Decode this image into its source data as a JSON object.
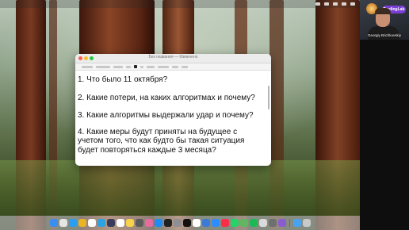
{
  "window": {
    "title": "Без названия — Изменено"
  },
  "questions": [
    "1. Что было 11 октября?",
    "2. Какие потери, на каких алгоритмах и почему?",
    "3. Какие алгоритмы выдержали удар и почему?",
    "4. Какие меры будут приняты  на будущее с\nучетом того, что как будто бы такая ситуация\nбудет повторяться каждые 3 месяца?"
  ],
  "video": {
    "participant_name": "Georgiy Brichkovskiy",
    "sign_text": "TradingLab"
  },
  "colors": {
    "traffic_close": "#ff5f57",
    "traffic_min": "#febc2e",
    "traffic_max": "#28c840",
    "sign": "#7b3fd6"
  },
  "dock": {
    "icons": [
      {
        "name": "finder-icon",
        "color": "#3b8df0"
      },
      {
        "name": "launchpad-icon",
        "color": "#e5e5e5"
      },
      {
        "name": "safari-icon",
        "color": "#2a9df4"
      },
      {
        "name": "chrome-icon",
        "color": "#e9b526"
      },
      {
        "name": "yandex-icon",
        "color": "#fbfbfb"
      },
      {
        "name": "telegram-icon",
        "color": "#2aa3e0"
      },
      {
        "name": "shield-icon",
        "color": "#3a3a5a"
      },
      {
        "name": "calendar-icon",
        "color": "#ffffff"
      },
      {
        "name": "notes-icon",
        "color": "#f7d34a"
      },
      {
        "name": "app-icon",
        "color": "#5b5b5b"
      },
      {
        "name": "photos-icon",
        "color": "#e86ba0"
      },
      {
        "name": "appstore-icon",
        "color": "#1e8cf2"
      },
      {
        "name": "stocks-icon",
        "color": "#202020"
      },
      {
        "name": "settings-icon",
        "color": "#8e8e93"
      },
      {
        "name": "terminal-icon",
        "color": "#111111"
      },
      {
        "name": "reminders-icon",
        "color": "#ffffff"
      },
      {
        "name": "vpn-icon",
        "color": "#3d7ad6"
      },
      {
        "name": "zoom-icon",
        "color": "#2d8cff"
      },
      {
        "name": "music-icon",
        "color": "#fa2d48"
      },
      {
        "name": "whatsapp-icon",
        "color": "#25d366"
      },
      {
        "name": "maps-icon",
        "color": "#5fb85f"
      },
      {
        "name": "spotify-icon",
        "color": "#1db954"
      },
      {
        "name": "textedit-icon",
        "color": "#dadada"
      },
      {
        "name": "preview-icon",
        "color": "#6f6f6f"
      },
      {
        "name": "app2-icon",
        "color": "#8a5cd1"
      },
      {
        "name": "downloads-icon",
        "color": "#4aa3f0"
      },
      {
        "name": "trash-icon",
        "color": "#c9c9c9"
      }
    ]
  }
}
